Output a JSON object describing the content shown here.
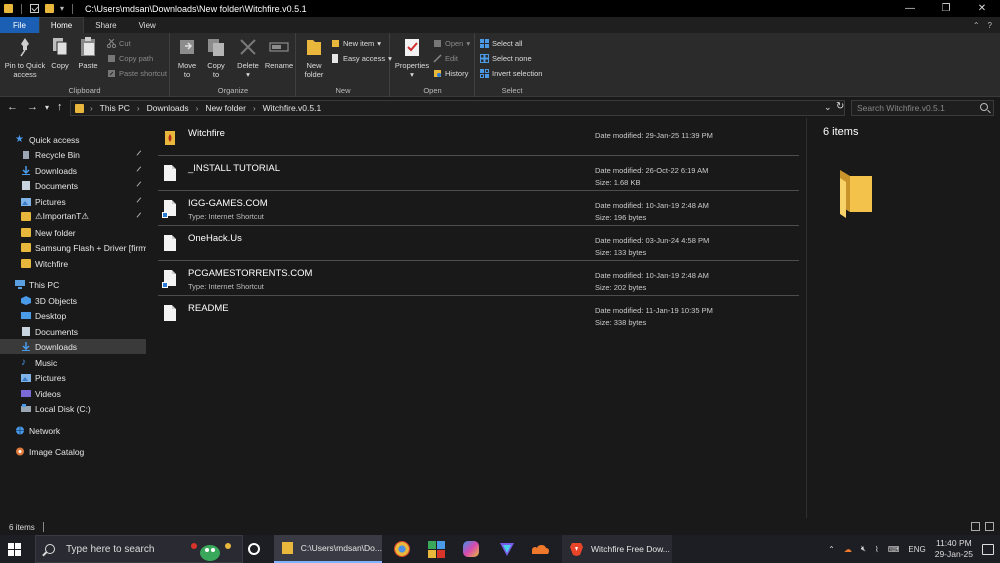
{
  "window": {
    "title": "C:\\Users\\mdsan\\Downloads\\New folder\\Witchfire.v0.5.1",
    "controls": {
      "minimize": "—",
      "maximize": "❐",
      "close": "✕"
    }
  },
  "tabs": [
    {
      "label": "File"
    },
    {
      "label": "Home"
    },
    {
      "label": "Share"
    },
    {
      "label": "View"
    }
  ],
  "ribbon": {
    "clipboard": {
      "label": "Clipboard",
      "pin_line1": "Pin to Quick",
      "pin_line2": "access",
      "copy": "Copy",
      "paste": "Paste",
      "cut": "Cut",
      "copy_path": "Copy path",
      "paste_shortcut": "Paste shortcut"
    },
    "organize": {
      "label": "Organize",
      "move_line1": "Move",
      "move_line2": "to",
      "copy_line1": "Copy",
      "copy_line2": "to",
      "delete": "Delete",
      "rename": "Rename"
    },
    "new": {
      "label": "New",
      "new_folder_line1": "New",
      "new_folder_line2": "folder",
      "new_item": "New item",
      "easy_access": "Easy access"
    },
    "open": {
      "label": "Open",
      "properties": "Properties",
      "open": "Open",
      "edit": "Edit",
      "history": "History"
    },
    "select": {
      "label": "Select",
      "select_all": "Select all",
      "select_none": "Select none",
      "invert_selection": "Invert selection"
    }
  },
  "address": {
    "crumbs": [
      "This PC",
      "Downloads",
      "New folder",
      "Witchfire.v0.5.1"
    ],
    "search_placeholder": "Search Witchfire.v0.5.1"
  },
  "sidebar": {
    "quick_access": "Quick access",
    "quick_items": [
      {
        "label": "Recycle Bin"
      },
      {
        "label": "Downloads"
      },
      {
        "label": "Documents"
      },
      {
        "label": "Pictures"
      },
      {
        "label": "⚠ImportanT⚠"
      },
      {
        "label": "New folder"
      },
      {
        "label": "Samsung Flash + Driver [firmv"
      },
      {
        "label": "Witchfire"
      }
    ],
    "this_pc": "This PC",
    "pc_items": [
      {
        "label": "3D Objects"
      },
      {
        "label": "Desktop"
      },
      {
        "label": "Documents"
      },
      {
        "label": "Downloads"
      },
      {
        "label": "Music"
      },
      {
        "label": "Pictures"
      },
      {
        "label": "Videos"
      },
      {
        "label": "Local Disk (C:)"
      }
    ],
    "network": "Network",
    "image_catalog": "Image Catalog"
  },
  "files": [
    {
      "name": "Witchfire",
      "type": "",
      "date": "Date modified: 29-Jan-25 11:39 PM",
      "size": ""
    },
    {
      "name": "_INSTALL TUTORIAL",
      "type": "",
      "date": "Date modified: 26-Oct-22 6:19 AM",
      "size": "Size: 1.68 KB"
    },
    {
      "name": "IGG-GAMES.COM",
      "type": "Type: Internet Shortcut",
      "date": "Date modified: 10-Jan-19 2:48 AM",
      "size": "Size: 196 bytes"
    },
    {
      "name": "OneHack.Us",
      "type": "",
      "date": "Date modified: 03-Jun-24 4:58 PM",
      "size": "Size: 133 bytes"
    },
    {
      "name": "PCGAMESTORRENTS.COM",
      "type": "Type: Internet Shortcut",
      "date": "Date modified: 10-Jan-19 2:48 AM",
      "size": "Size: 202 bytes"
    },
    {
      "name": "README",
      "type": "",
      "date": "Date modified: 11-Jan-19 10:35 PM",
      "size": "Size: 338 bytes"
    }
  ],
  "details": {
    "item_count": "6 items"
  },
  "status": {
    "item_count": "6 items"
  },
  "taskbar": {
    "search_placeholder": "Type here to search",
    "explorer_label": "C:\\Users\\mdsan\\Do...",
    "browser_label": "Witchfire Free Dow...",
    "language": "ENG",
    "time": "11:40 PM",
    "date": "29-Jan-25"
  }
}
